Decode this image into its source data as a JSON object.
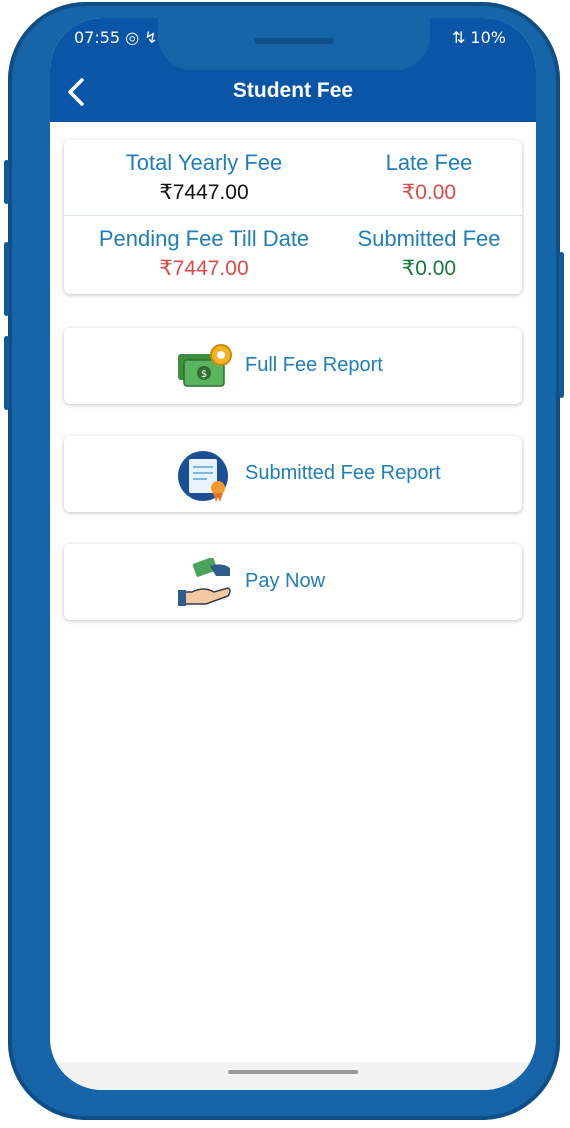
{
  "status_bar": {
    "time": "07:55 ◎ ↯",
    "right": "⇅ 10%"
  },
  "header": {
    "title": "Student Fee"
  },
  "summary": {
    "total_yearly_label": "Total Yearly Fee",
    "total_yearly_value": "₹7447.00",
    "late_fee_label": "Late Fee",
    "late_fee_value": "₹0.00",
    "pending_label": "Pending Fee Till Date",
    "pending_value": "₹7447.00",
    "submitted_label": "Submitted Fee",
    "submitted_value": "₹0.00"
  },
  "menu": [
    {
      "label": "Full Fee Report",
      "icon": "money-gear-icon"
    },
    {
      "label": "Submitted Fee Report",
      "icon": "certificate-document-icon"
    },
    {
      "label": "Pay Now",
      "icon": "hand-money-icon"
    }
  ],
  "colors": {
    "primary": "#0b55a6",
    "label": "#1e7fb8",
    "red": "#e04848",
    "green": "#137a3c"
  }
}
